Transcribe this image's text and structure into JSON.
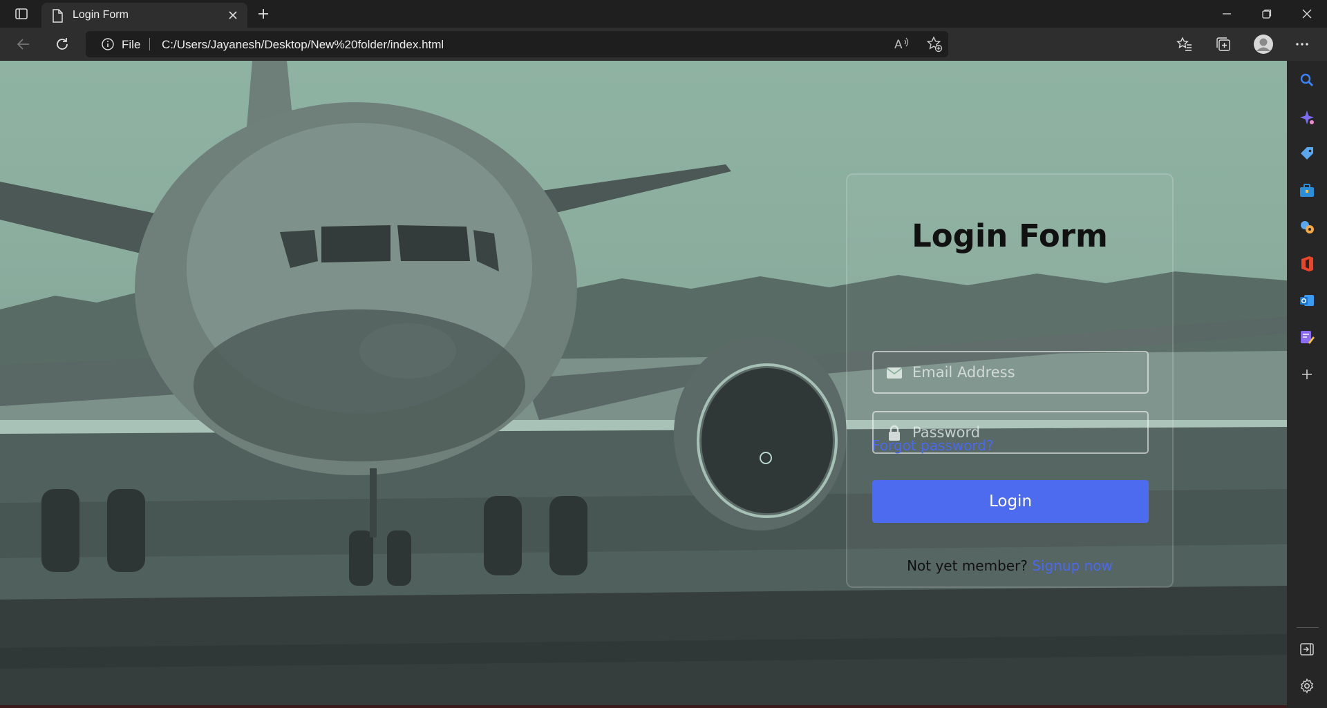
{
  "browser": {
    "tab_title": "Login Form",
    "omnibox": {
      "scheme_label": "File",
      "url": "C:/Users/Jayanesh/Desktop/New%20folder/index.html"
    },
    "icons": {
      "tab_actions": "tab-actions-icon",
      "page": "page-icon",
      "close_tab": "close-icon",
      "new_tab": "plus-icon",
      "minimize": "minimize-icon",
      "restore": "restore-icon",
      "close_window": "close-icon",
      "back": "back-arrow-icon",
      "refresh": "refresh-icon",
      "site_info": "info-icon",
      "read_aloud": "read-aloud-icon",
      "add_favorite": "add-favorite-icon",
      "favorites": "favorites-icon",
      "collections": "collections-icon",
      "profile": "profile-avatar-icon",
      "more": "more-icon"
    }
  },
  "sidebar": {
    "items": [
      "search-icon",
      "copilot-icon",
      "shopping-icon",
      "tools-icon",
      "games-icon",
      "office-icon",
      "outlook-icon",
      "designer-icon",
      "add-icon"
    ],
    "bottom": [
      "hide-sidebar-icon",
      "settings-icon"
    ]
  },
  "login": {
    "title": "Login Form",
    "email_placeholder": "Email Address",
    "password_placeholder": "Password",
    "forgot_label": "Forgot password?",
    "login_label": "Login",
    "signup_text": "Not yet member?",
    "signup_link": "Signup now"
  },
  "colors": {
    "accent": "#4d6bef",
    "link": "#4b68f0",
    "overlay_tint": "#8fb3a3"
  }
}
